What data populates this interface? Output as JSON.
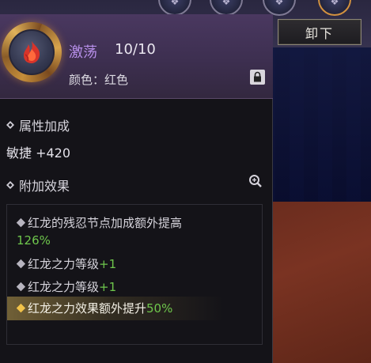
{
  "unequip_button": {
    "label": "卸下"
  },
  "gem": {
    "name": "激荡",
    "level": "10/10",
    "color_label": "颜色：红色",
    "icon": "red-flame-gem-icon"
  },
  "attributes": {
    "header": "属性加成",
    "stat": "敏捷 +420"
  },
  "effects": {
    "header": "附加效果",
    "items": [
      {
        "text": "红龙的残忍节点加成额外提高",
        "value": "126%"
      },
      {
        "text": "红龙之力等级",
        "value": "+1"
      },
      {
        "text": "红龙之力等级",
        "value": "+1"
      },
      {
        "text": "红龙之力效果额外提升",
        "value": "50%"
      }
    ]
  },
  "colors": {
    "gem_name": "#b68ee8",
    "bonus_value": "#6ec64c",
    "highlight_bullet": "#f1c24a",
    "panel_header": "#3d2f50"
  }
}
